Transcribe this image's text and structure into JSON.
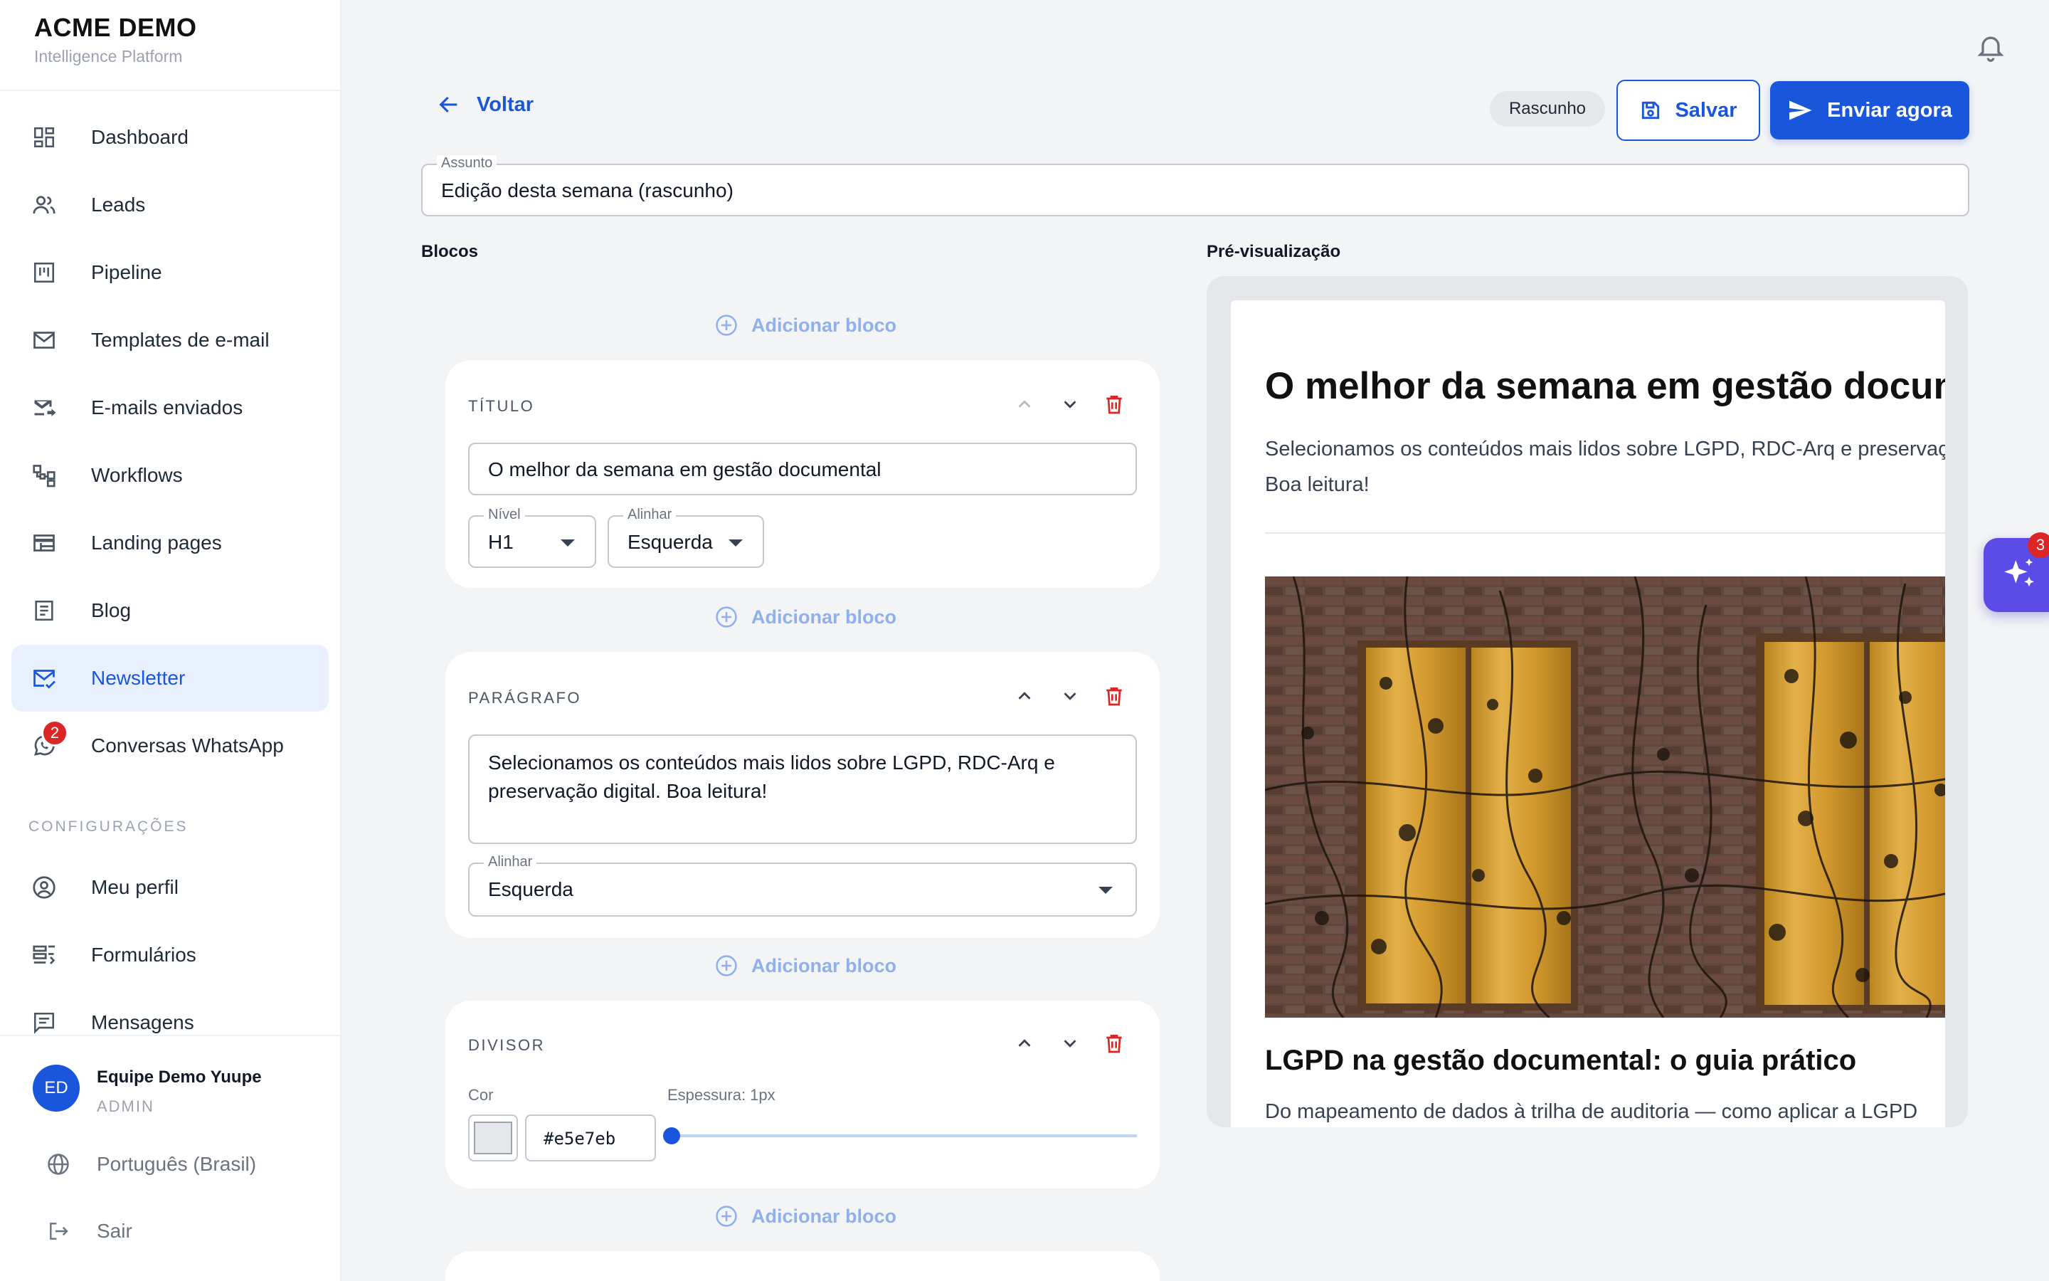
{
  "brand": {
    "title": "ACME DEMO",
    "subtitle": "Intelligence Platform"
  },
  "nav": {
    "items": [
      {
        "label": "Dashboard",
        "icon": "dashboard-icon"
      },
      {
        "label": "Leads",
        "icon": "users-icon"
      },
      {
        "label": "Pipeline",
        "icon": "kanban-icon"
      },
      {
        "label": "Templates de e-mail",
        "icon": "mail-icon"
      },
      {
        "label": "E-mails enviados",
        "icon": "mail-sent-icon"
      },
      {
        "label": "Workflows",
        "icon": "workflow-icon"
      },
      {
        "label": "Landing pages",
        "icon": "web-icon"
      },
      {
        "label": "Blog",
        "icon": "article-icon"
      },
      {
        "label": "Newsletter",
        "icon": "newsletter-icon",
        "active": true
      },
      {
        "label": "Conversas WhatsApp",
        "icon": "whatsapp-icon",
        "badge": "2"
      }
    ],
    "section_label": "CONFIGURAÇÕES",
    "settings": [
      {
        "label": "Meu perfil",
        "icon": "profile-icon"
      },
      {
        "label": "Formulários",
        "icon": "form-icon"
      },
      {
        "label": "Mensagens",
        "icon": "message-icon"
      }
    ]
  },
  "user": {
    "initials": "ED",
    "name": "Equipe Demo Yuupe",
    "role": "ADMIN"
  },
  "footer": {
    "language": "Português (Brasil)",
    "logout": "Sair"
  },
  "toolbar": {
    "back_label": "Voltar",
    "status": "Rascunho",
    "save_label": "Salvar",
    "send_label": "Enviar agora"
  },
  "subject": {
    "label": "Assunto",
    "value": "Edição desta semana (rascunho)"
  },
  "blocks": {
    "title": "Blocos",
    "add_label": "Adicionar bloco",
    "heading": {
      "type_label": "TÍTULO",
      "text": "O melhor da semana em gestão documental",
      "level_label": "Nível",
      "level_value": "H1",
      "align_label": "Alinhar",
      "align_value": "Esquerda"
    },
    "paragraph": {
      "type_label": "PARÁGRAFO",
      "text": "Selecionamos os conteúdos mais lidos sobre LGPD, RDC-Arq e preservação digital. Boa leitura!",
      "align_label": "Alinhar",
      "align_value": "Esquerda"
    },
    "divider": {
      "type_label": "DIVISOR",
      "color_label": "Cor",
      "color_value": "#e5e7eb",
      "thickness_label": "Espessura: 1px",
      "thickness_fraction": 0.0
    }
  },
  "preview": {
    "title": "Pré-visualização",
    "h1": "O melhor da semana em gestão documental",
    "paragraph": "Selecionamos os conteúdos mais lidos sobre LGPD, RDC-Arq e preservação digital. Boa leitura!",
    "h2": "LGPD na gestão documental: o guia prático",
    "excerpt": "Do mapeamento de dados à trilha de auditoria — como aplicar a LGPD"
  },
  "assistant": {
    "badge": "3"
  },
  "colors": {
    "primary": "#1a56db",
    "danger": "#dc2626",
    "assistant": "#5b4ce8"
  }
}
